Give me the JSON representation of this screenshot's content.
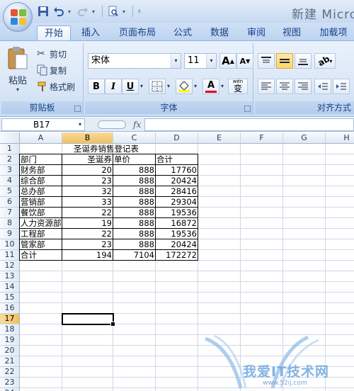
{
  "window": {
    "title": "新建 Micro"
  },
  "tabs": [
    {
      "label": "开始",
      "active": true
    },
    {
      "label": "插入"
    },
    {
      "label": "页面布局"
    },
    {
      "label": "公式"
    },
    {
      "label": "数据"
    },
    {
      "label": "审阅"
    },
    {
      "label": "视图"
    },
    {
      "label": "加载项"
    }
  ],
  "clipboard": {
    "paste_label": "粘贴",
    "cut_label": "剪切",
    "copy_label": "复制",
    "format_painter_label": "格式刷",
    "group_label": "剪贴板"
  },
  "font": {
    "font_name": "宋体",
    "font_size": "11",
    "grow_label": "A",
    "shrink_label": "A",
    "bold_label": "B",
    "italic_label": "I",
    "underline_label": "U",
    "color_label": "A",
    "phonetic_label": "wén",
    "phonetic_char": "变",
    "group_label": "字体"
  },
  "alignment": {
    "group_label": "对齐方式"
  },
  "formula_bar": {
    "name_box": "B17",
    "fx_label": "fx",
    "value": ""
  },
  "sheet": {
    "columns": [
      "A",
      "B",
      "C",
      "D",
      "E",
      "F",
      "G",
      "H"
    ],
    "rows": [
      "1",
      "2",
      "3",
      "4",
      "5",
      "6",
      "7",
      "8",
      "9",
      "10",
      "11",
      "12",
      "13",
      "14",
      "15",
      "16",
      "17",
      "18",
      "19",
      "20",
      "21",
      "22",
      "23",
      "24"
    ],
    "title": "圣诞券销售登记表",
    "headers": [
      "部门",
      "圣诞券",
      "单价",
      "合计"
    ],
    "data": [
      [
        "财务部",
        "20",
        "888",
        "17760"
      ],
      [
        "综合部",
        "23",
        "888",
        "20424"
      ],
      [
        "总办部",
        "32",
        "888",
        "28416"
      ],
      [
        "营销部",
        "33",
        "888",
        "29304"
      ],
      [
        "餐饮部",
        "22",
        "888",
        "19536"
      ],
      [
        "人力资源部",
        "19",
        "888",
        "16872"
      ],
      [
        "工程部",
        "22",
        "888",
        "19536"
      ],
      [
        "管家部",
        "23",
        "888",
        "20424"
      ]
    ],
    "total": [
      "合计",
      "194",
      "7104",
      "172272"
    ],
    "active_cell": "B17"
  },
  "watermark": {
    "text": "我爱IT技术网",
    "url": "www.52ij.com"
  }
}
